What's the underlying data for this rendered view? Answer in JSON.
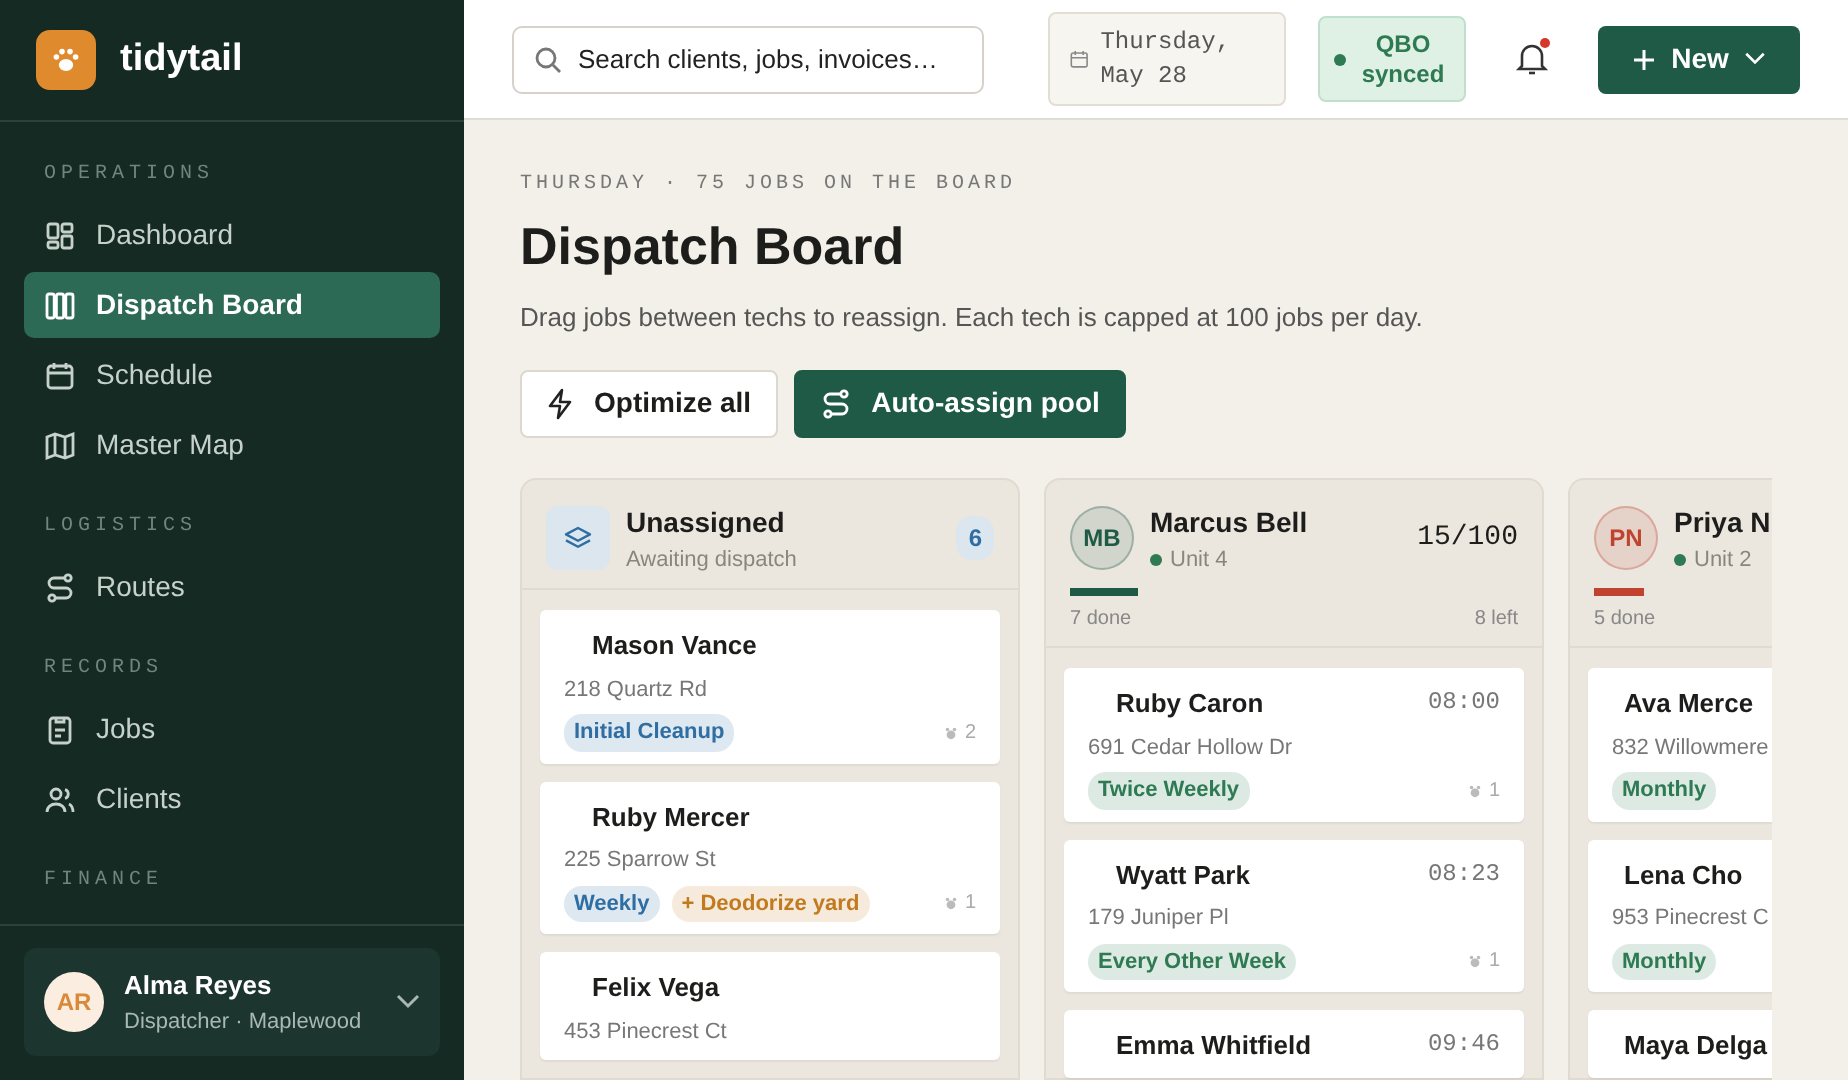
{
  "brand": {
    "name": "tidytail"
  },
  "sidebar": {
    "sections": [
      {
        "label": "OPERATIONS",
        "items": [
          {
            "label": "Dashboard",
            "selected": false
          },
          {
            "label": "Dispatch Board",
            "selected": true
          },
          {
            "label": "Schedule",
            "selected": false
          },
          {
            "label": "Master Map",
            "selected": false
          }
        ]
      },
      {
        "label": "LOGISTICS",
        "items": [
          {
            "label": "Routes",
            "selected": false
          }
        ]
      },
      {
        "label": "RECORDS",
        "items": [
          {
            "label": "Jobs",
            "selected": false
          },
          {
            "label": "Clients",
            "selected": false
          }
        ]
      },
      {
        "label": "FINANCE"
      }
    ],
    "user": {
      "initials": "AR",
      "name": "Alma Reyes",
      "role": "Dispatcher · Maplewood"
    }
  },
  "topbar": {
    "search": {
      "placeholder": "Search clients, jobs, invoices…"
    },
    "date": "Thursday, May 28",
    "sync": "QBO synced",
    "notifications_unread": true,
    "new_button": "New"
  },
  "header": {
    "eyebrow": "THURSDAY · 75 JOBS ON THE BOARD",
    "title": "Dispatch Board",
    "subtitle": "Drag jobs between techs to reassign. Each tech is capped at 100 jobs per day.",
    "actions": [
      {
        "label": "Optimize all",
        "kind": "secondary"
      },
      {
        "label": "Auto-assign pool",
        "kind": "primary"
      }
    ]
  },
  "columns": [
    {
      "kind": "pool",
      "title": "Unassigned",
      "subtitle": "Awaiting dispatch",
      "count": "6",
      "jobs": [
        {
          "client": "Mason Vance",
          "address": "218 Quartz Rd",
          "tags": [
            {
              "label": "Initial Cleanup",
              "color": "#2f6ea3"
            }
          ],
          "dogs": "2"
        },
        {
          "client": "Ruby Mercer",
          "address": "225 Sparrow St",
          "tags": [
            {
              "label": "Weekly",
              "color": "#2f6ea3"
            },
            {
              "label": "+ Deodorize yard",
              "color": "#c27a1e"
            }
          ],
          "dogs": "1"
        },
        {
          "client": "Felix Vega",
          "address": "453 Pinecrest Ct"
        }
      ]
    },
    {
      "kind": "tech",
      "initials": "MB",
      "title": "Marcus Bell",
      "unit": "Unit 4",
      "color": "#1f5a47",
      "capacity": "15/100",
      "level": 0.15,
      "done": "7 done",
      "left": "8 left",
      "jobs": [
        {
          "client": "Ruby Caron",
          "time": "08:00",
          "address": "691 Cedar Hollow Dr",
          "tags": [
            {
              "label": "Twice Weekly",
              "color": "#2e7a52"
            }
          ],
          "dogs": "1"
        },
        {
          "client": "Wyatt Park",
          "time": "08:23",
          "address": "179 Juniper Pl",
          "tags": [
            {
              "label": "Every Other Week",
              "color": "#2e7a52"
            }
          ],
          "dogs": "1"
        },
        {
          "client": "Emma Whitfield",
          "time": "09:46"
        }
      ]
    },
    {
      "kind": "tech",
      "initials": "PN",
      "title": "Priya N",
      "unit": "Unit 2",
      "color": "#c0432f",
      "level": 0.11,
      "done": "5 done",
      "jobs": [
        {
          "client": "Ava Merce",
          "address": "832 Willowmere",
          "tags": [
            {
              "label": "Monthly",
              "color": "#2e7a52"
            }
          ]
        },
        {
          "client": "Lena Cho",
          "address": "953 Pinecrest C",
          "tags": [
            {
              "label": "Monthly",
              "color": "#2e7a52"
            }
          ]
        },
        {
          "client": "Maya Delga"
        }
      ]
    }
  ]
}
